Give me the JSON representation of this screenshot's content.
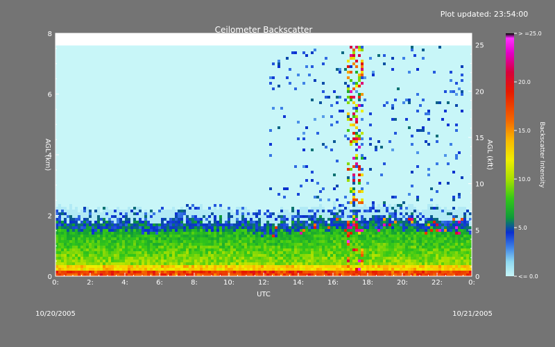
{
  "header": {
    "updated": "Plot updated: 23:54:00"
  },
  "dates": {
    "start": "10/20/2005",
    "end": "10/21/2005"
  },
  "colors": {
    "background": "#747474",
    "sky": "#c8f6f8"
  },
  "chart_data": {
    "type": "heatmap",
    "title": "Ceilometer Backscatter",
    "xlabel": "UTC",
    "ylabel_left": "AGL (km)",
    "ylabel_right": "AGL (kft)",
    "colorbar_label": "Backscatter Intensity",
    "xlim": [
      0,
      24
    ],
    "ylim_left": [
      0,
      8
    ],
    "ylim_right": [
      0,
      26.25
    ],
    "data_top_km": 7.6,
    "x_ticks": [
      {
        "v": 0,
        "t": "0:"
      },
      {
        "v": 2,
        "t": "2:"
      },
      {
        "v": 4,
        "t": "4:"
      },
      {
        "v": 6,
        "t": "6:"
      },
      {
        "v": 8,
        "t": "8:"
      },
      {
        "v": 10,
        "t": "10:"
      },
      {
        "v": 12,
        "t": "12:"
      },
      {
        "v": 14,
        "t": "14:"
      },
      {
        "v": 16,
        "t": "16:"
      },
      {
        "v": 18,
        "t": "18:"
      },
      {
        "v": 20,
        "t": "20:"
      },
      {
        "v": 22,
        "t": "22:"
      },
      {
        "v": 24,
        "t": "0:"
      }
    ],
    "y_ticks_left": [
      {
        "v": 0,
        "t": "0"
      },
      {
        "v": 2,
        "t": "2"
      },
      {
        "v": 4,
        "t": "4"
      },
      {
        "v": 6,
        "t": "6"
      },
      {
        "v": 8,
        "t": "8"
      }
    ],
    "y_ticks_right": [
      {
        "v": 0,
        "t": "0"
      },
      {
        "v": 5,
        "t": "5"
      },
      {
        "v": 10,
        "t": "10"
      },
      {
        "v": 15,
        "t": "15"
      },
      {
        "v": 20,
        "t": "20"
      },
      {
        "v": 25,
        "t": "25"
      }
    ],
    "colorbar_range": [
      0,
      25
    ],
    "colorbar_ticks": [
      {
        "v": 0,
        "t": "<= 0.0"
      },
      {
        "v": 5,
        "t": "5.0"
      },
      {
        "v": 10,
        "t": "10.0"
      },
      {
        "v": 15,
        "t": "15.0"
      },
      {
        "v": 20,
        "t": "20.0"
      },
      {
        "v": 25,
        "t": "> =25.0"
      }
    ],
    "colormap": [
      {
        "v": 0,
        "c": "#c8f6f8"
      },
      {
        "v": 1.5,
        "c": "#8ed8f0"
      },
      {
        "v": 3,
        "c": "#3c80e6"
      },
      {
        "v": 4.5,
        "c": "#0a2ed2"
      },
      {
        "v": 6,
        "c": "#0e9a3a"
      },
      {
        "v": 8,
        "c": "#34c818"
      },
      {
        "v": 10,
        "c": "#a8e000"
      },
      {
        "v": 12,
        "c": "#f0ee00"
      },
      {
        "v": 14,
        "c": "#f8b800"
      },
      {
        "v": 16,
        "c": "#f46800"
      },
      {
        "v": 19,
        "c": "#e61a00"
      },
      {
        "v": 21,
        "c": "#d8003c"
      },
      {
        "v": 23,
        "c": "#e400c8"
      },
      {
        "v": 24.5,
        "c": "#ff30ff"
      },
      {
        "v": 25,
        "c": "#000000"
      }
    ],
    "boundary_layer_top_km": [
      {
        "x": 0,
        "y": 1.85
      },
      {
        "x": 2,
        "y": 1.8
      },
      {
        "x": 4,
        "y": 1.85
      },
      {
        "x": 6,
        "y": 1.8
      },
      {
        "x": 8,
        "y": 1.9
      },
      {
        "x": 10,
        "y": 1.85
      },
      {
        "x": 12,
        "y": 1.7
      },
      {
        "x": 14,
        "y": 1.8
      },
      {
        "x": 16,
        "y": 1.9
      },
      {
        "x": 18,
        "y": 1.95
      },
      {
        "x": 20,
        "y": 1.9
      },
      {
        "x": 22,
        "y": 1.85
      },
      {
        "x": 24,
        "y": 1.8
      }
    ]
  }
}
